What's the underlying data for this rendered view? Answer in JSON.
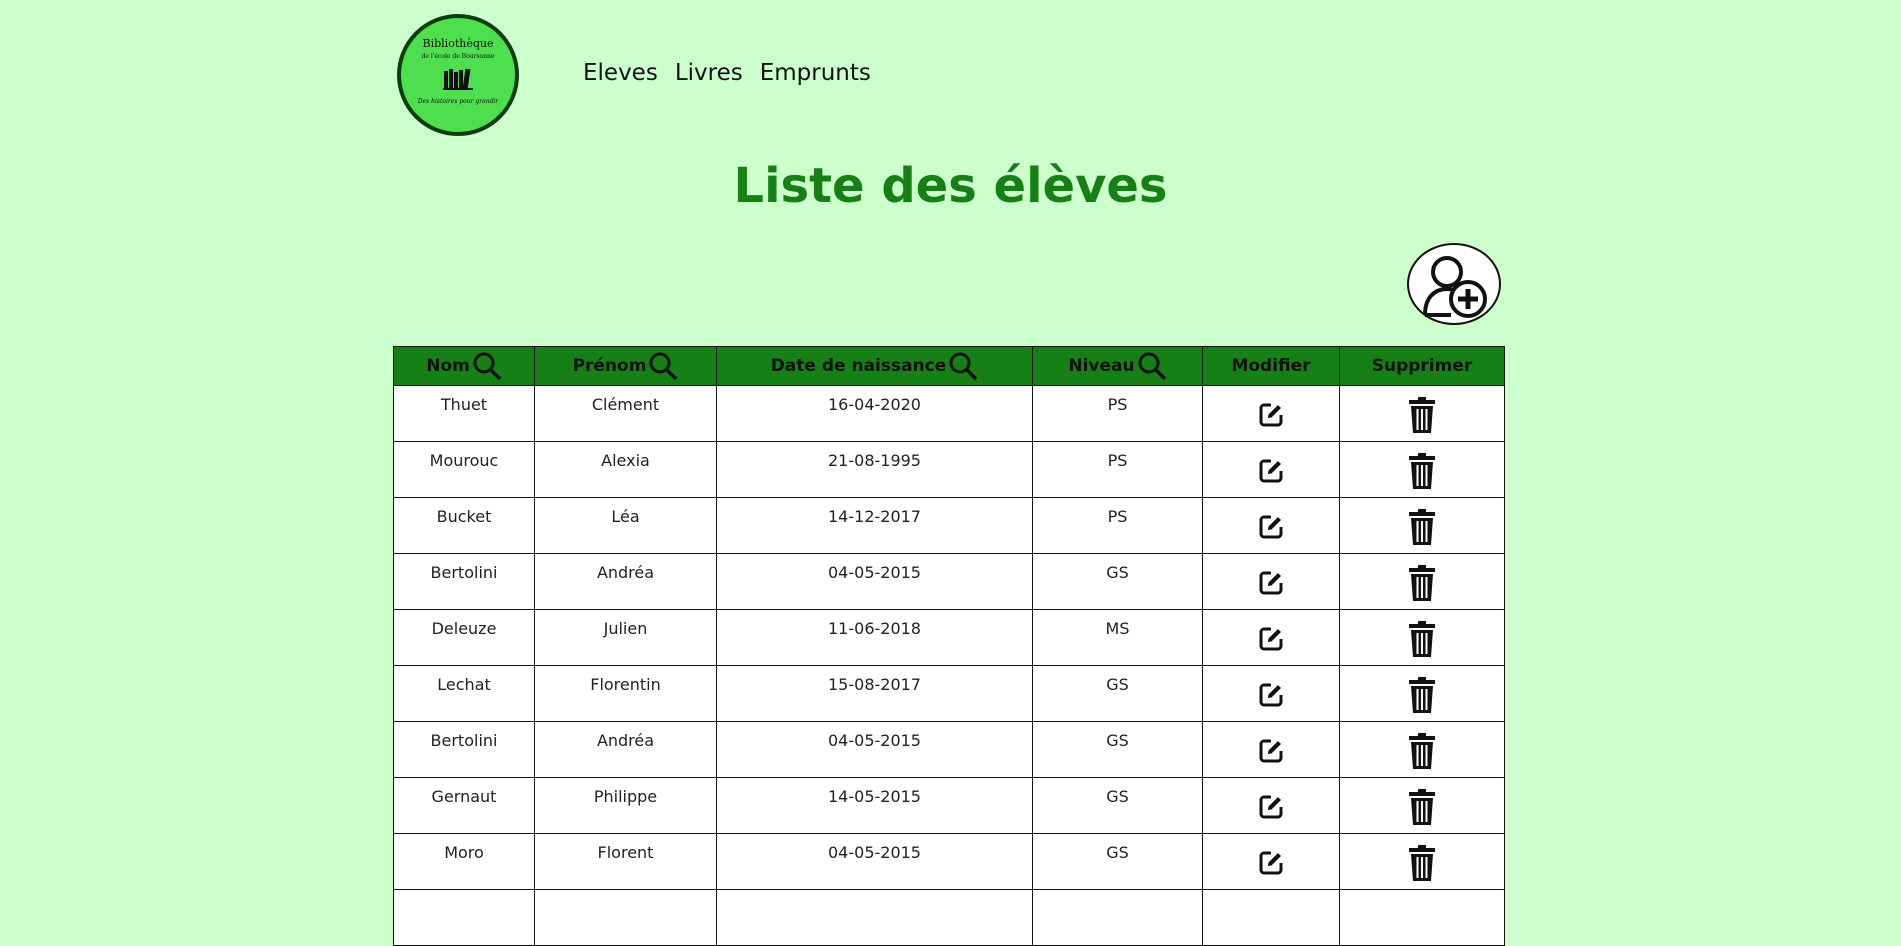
{
  "logo": {
    "title": "Bibliothèque",
    "subtitle": "de l'école de Boursonne",
    "tagline": "Des histoires pour grandir"
  },
  "nav": {
    "items": [
      "Eleves",
      "Livres",
      "Emprunts"
    ]
  },
  "page": {
    "title": "Liste des élèves"
  },
  "table": {
    "headers": {
      "nom": "Nom",
      "prenom": "Prénom",
      "date": "Date de naissance",
      "niveau": "Niveau",
      "modifier": "Modifier",
      "supprimer": "Supprimer"
    },
    "rows": [
      {
        "nom": "Thuet",
        "prenom": "Clément",
        "date": "16-04-2020",
        "niveau": "PS"
      },
      {
        "nom": "Mourouc",
        "prenom": "Alexia",
        "date": "21-08-1995",
        "niveau": "PS"
      },
      {
        "nom": "Bucket",
        "prenom": "Léa",
        "date": "14-12-2017",
        "niveau": "PS"
      },
      {
        "nom": "Bertolini",
        "prenom": "Andréa",
        "date": "04-05-2015",
        "niveau": "GS"
      },
      {
        "nom": "Deleuze",
        "prenom": "Julien",
        "date": "11-06-2018",
        "niveau": "MS"
      },
      {
        "nom": "Lechat",
        "prenom": "Florentin",
        "date": "15-08-2017",
        "niveau": "GS"
      },
      {
        "nom": "Bertolini",
        "prenom": "Andréa",
        "date": "04-05-2015",
        "niveau": "GS"
      },
      {
        "nom": "Gernaut",
        "prenom": "Philippe",
        "date": "14-05-2015",
        "niveau": "GS"
      },
      {
        "nom": "Moro",
        "prenom": "Florent",
        "date": "04-05-2015",
        "niveau": "GS"
      }
    ]
  },
  "colors": {
    "background": "#ccffcc",
    "accent": "#168016",
    "logo_fill": "#4ddf4d"
  },
  "icons": {
    "header_search": "search-icon",
    "add": "add-user-icon",
    "edit": "edit-icon",
    "delete": "trash-icon"
  }
}
